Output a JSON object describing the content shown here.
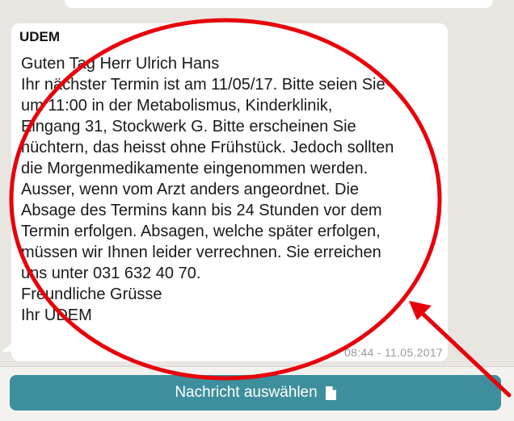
{
  "message": {
    "sender": "UDEM",
    "lines": [
      "Guten Tag  Herr Ulrich Hans",
      "Ihr nächster Termin ist am  11/05/17. Bitte seien Sie",
      "um  11:00 in der  Metabolismus, Kinderklinik,",
      "Eingang 31, Stockwerk G. Bitte erscheinen Sie",
      "nüchtern, das heisst ohne Frühstück. Jedoch sollten",
      "die Morgenmedikamente eingenommen werden.",
      "Ausser, wenn vom Arzt anders angeordnet. Die",
      "Absage des Termins kann bis 24 Stunden vor dem",
      "Termin erfolgen. Absagen, welche später erfolgen,",
      "müssen wir Ihnen leider verrechnen. Sie erreichen",
      "uns unter 031 632 40 70.",
      "Freundliche Grüsse",
      "Ihr UDEM"
    ],
    "timestamp": "08:44 - 11.05.2017"
  },
  "action_button": {
    "label": "Nachricht auswählen",
    "icon": "document-icon"
  },
  "colors": {
    "button": "#3e8f9d",
    "annotation": "#e8000b",
    "background": "#e9e6e2"
  }
}
